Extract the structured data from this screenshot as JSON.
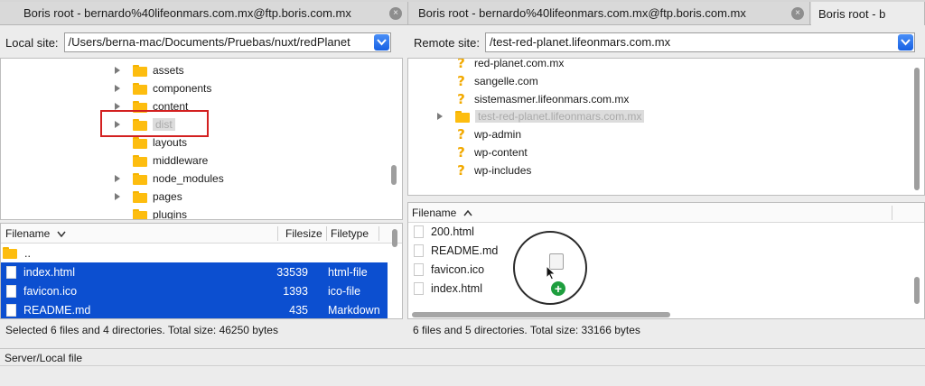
{
  "tabs": [
    {
      "label": "Boris root - bernardo%40lifeonmars.com.mx@ftp.boris.com.mx",
      "close": "×"
    },
    {
      "label": "Boris root - bernardo%40lifeonmars.com.mx@ftp.boris.com.mx",
      "close": "×"
    },
    {
      "label": "Boris root - b",
      "close": ""
    }
  ],
  "local_site": {
    "label": "Local site:",
    "path": "/Users/berna-mac/Documents/Pruebas/nuxt/redPlanet"
  },
  "remote_site": {
    "label": "Remote site:",
    "path": "/test-red-planet.lifeonmars.com.mx"
  },
  "local_tree": [
    {
      "name": "assets",
      "expandable": true
    },
    {
      "name": "components",
      "expandable": true
    },
    {
      "name": "content",
      "expandable": true
    },
    {
      "name": "dist",
      "expandable": true,
      "selected": true
    },
    {
      "name": "layouts",
      "expandable": false
    },
    {
      "name": "middleware",
      "expandable": false
    },
    {
      "name": "node_modules",
      "expandable": true
    },
    {
      "name": "pages",
      "expandable": true
    },
    {
      "name": "plugins",
      "expandable": false
    }
  ],
  "remote_tree": [
    {
      "name": "red-planet.com.mx",
      "icon": "question"
    },
    {
      "name": "sangelle.com",
      "icon": "question"
    },
    {
      "name": "sistemasmer.lifeonmars.com.mx",
      "icon": "question"
    },
    {
      "name": "test-red-planet.lifeonmars.com.mx",
      "icon": "folder",
      "expandable": true,
      "selected": true
    },
    {
      "name": "wp-admin",
      "icon": "question"
    },
    {
      "name": "wp-content",
      "icon": "question"
    },
    {
      "name": "wp-includes",
      "icon": "question"
    }
  ],
  "local_list": {
    "headers": {
      "filename": "Filename",
      "filesize": "Filesize",
      "filetype": "Filetype"
    },
    "rows": [
      {
        "name": "..",
        "size": "",
        "type": "",
        "kind": "folder",
        "selected": false
      },
      {
        "name": "index.html",
        "size": "33539",
        "type": "html-file",
        "kind": "file",
        "selected": true
      },
      {
        "name": "favicon.ico",
        "size": "1393",
        "type": "ico-file",
        "kind": "file",
        "selected": true
      },
      {
        "name": "README.md",
        "size": "435",
        "type": "Markdown",
        "kind": "file",
        "selected": true
      }
    ]
  },
  "remote_list": {
    "headers": {
      "filename": "Filename"
    },
    "rows": [
      {
        "name": "200.html"
      },
      {
        "name": "README.md"
      },
      {
        "name": "favicon.ico"
      },
      {
        "name": "index.html"
      }
    ]
  },
  "status": {
    "local": "Selected 6 files and 4 directories. Total size: 46250 bytes",
    "remote": "6 files and 5 directories. Total size: 33166 bytes"
  },
  "queue": {
    "label": "Server/Local file"
  },
  "drag": {
    "badge": "+"
  },
  "colors": {
    "selection": "#0c4fd0",
    "folder": "#fdbd0f",
    "highlight": "#d32020",
    "accent": "#1660e3"
  }
}
